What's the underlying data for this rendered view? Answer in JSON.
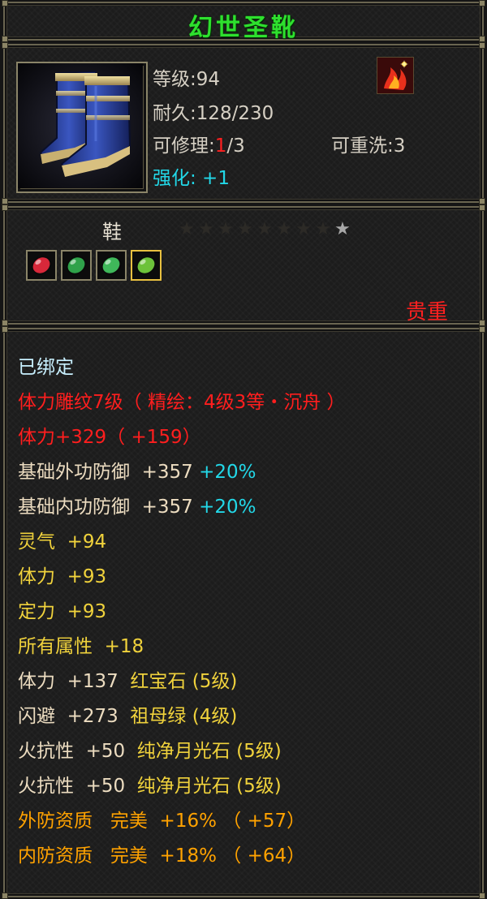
{
  "title": "幻世圣靴",
  "header": {
    "level_label": "等级:94",
    "durability_label": "耐久:128/230",
    "repair_prefix": "可修理:",
    "repair_count": "1",
    "repair_suffix": "/3",
    "rewash_label": "可重洗:3",
    "strengthen_label": "强化: +1"
  },
  "item_type": "鞋",
  "stars": {
    "filled": 1,
    "total": 9
  },
  "gem_sockets": [
    {
      "icon": "ruby-gem-icon",
      "color": "#d8283a"
    },
    {
      "icon": "emerald-gem-icon",
      "color": "#2fa24a"
    },
    {
      "icon": "jade-gem-icon",
      "color": "#3fb85a"
    },
    {
      "icon": "jade-gem-icon",
      "color": "#6cc23a",
      "selected": true
    }
  ],
  "grade": "贵重",
  "attributes": {
    "bound": "已绑定",
    "engrave": "体力雕纹7级（ 精绘：4级3等・沉舟 ）",
    "vit_main": "体力+329（ +159）",
    "ext_def": {
      "label": "基础外功防御  +357",
      "bonus": "+20%"
    },
    "int_def": {
      "label": "基础内功防御  +357",
      "bonus": "+20%"
    },
    "spirit": "灵气  +94",
    "vit": "体力  +93",
    "focus": "定力  +93",
    "all_attr": "所有属性  +18",
    "gem_lines": [
      {
        "stat": "体力  +137  ",
        "gem": "红宝石 (5级)"
      },
      {
        "stat": "闪避  +273  ",
        "gem": "祖母绿 (4级)"
      },
      {
        "stat": "火抗性  +50  ",
        "gem": "纯净月光石 (5级)"
      },
      {
        "stat": "火抗性  +50  ",
        "gem": "纯净月光石 (5级)"
      }
    ],
    "ext_quality": "外防资质   完美  +16% （ +57）",
    "int_quality": "内防资质   完美  +18% （ +64）"
  },
  "colors": {
    "title": "#2ee02e",
    "bound": "#c8f0ff",
    "red": "#ff1e1e",
    "cream": "#ecdcc0",
    "cyan": "#22d8e8",
    "yellow": "#f0d23c",
    "orange": "#ffa200"
  }
}
